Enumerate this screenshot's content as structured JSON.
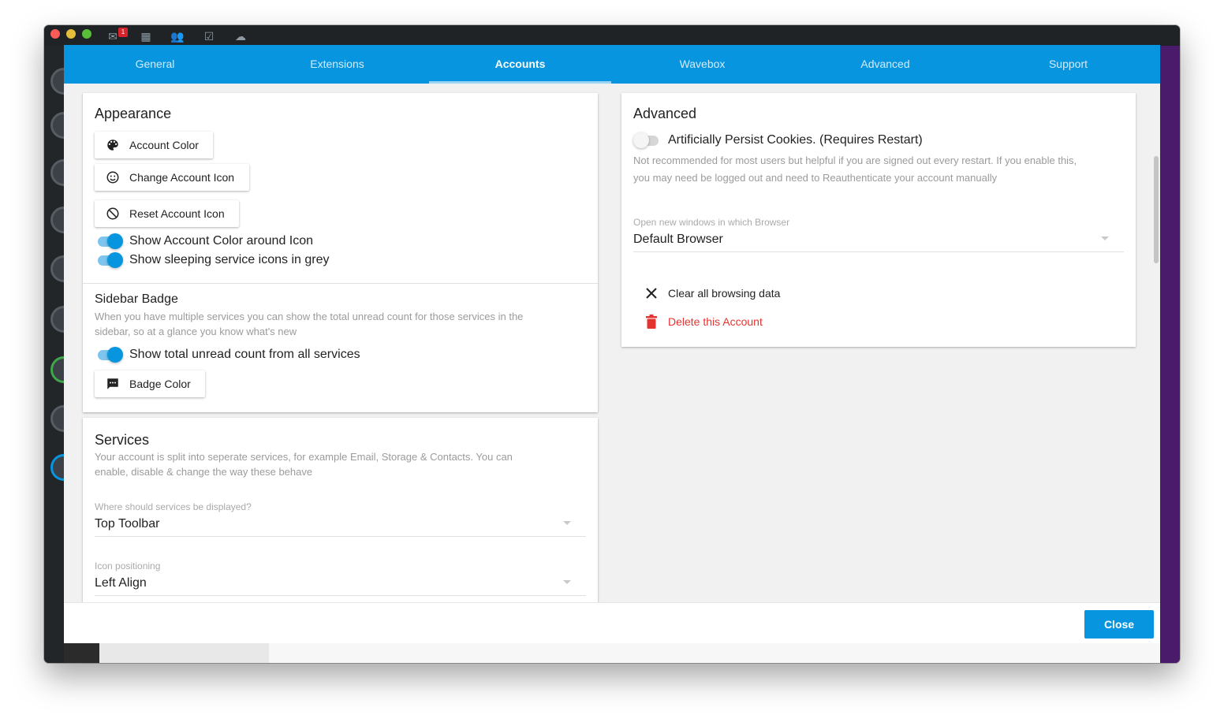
{
  "titlebar": {
    "mail_badge": "1"
  },
  "tabs": [
    {
      "label": "General"
    },
    {
      "label": "Extensions"
    },
    {
      "label": "Accounts"
    },
    {
      "label": "Wavebox"
    },
    {
      "label": "Advanced"
    },
    {
      "label": "Support"
    }
  ],
  "active_tab": "Accounts",
  "appearance": {
    "title": "Appearance",
    "account_color_btn": "Account Color",
    "change_icon_btn": "Change Account Icon",
    "reset_icon_btn": "Reset Account Icon",
    "show_color_toggle": "Show Account Color around Icon",
    "show_sleeping_toggle": "Show sleeping service icons in grey"
  },
  "sidebar_badge": {
    "title": "Sidebar Badge",
    "help_line1": "When you have multiple services you can show the total unread count for those services in the",
    "help_line2": "sidebar, so at a glance you know what's new",
    "total_unread_toggle": "Show total unread count from all services",
    "badge_color_btn": "Badge Color"
  },
  "services": {
    "title": "Services",
    "help_line1": "Your account is split into seperate services, for example Email, Storage & Contacts. You can",
    "help_line2": "enable, disable & change the way these behave",
    "display_label": "Where should services be displayed?",
    "display_value": "Top Toolbar",
    "icon_pos_label": "Icon positioning",
    "icon_pos_value": "Left Align"
  },
  "advanced": {
    "title": "Advanced",
    "persist_cookies_toggle": "Artificially Persist Cookies. (Requires Restart)",
    "persist_help_line1": "Not recommended for most users but helpful if you are signed out every restart. If you enable this,",
    "persist_help_line2": "you may need be logged out and need to Reauthenticate your account manually",
    "browser_label": "Open new windows in which Browser",
    "browser_value": "Default Browser",
    "clear_data": "Clear all browsing data",
    "delete_account": "Delete this Account"
  },
  "footer": {
    "close_label": "Close"
  },
  "colors": {
    "accent": "#0795e0",
    "danger": "#e3342f"
  }
}
